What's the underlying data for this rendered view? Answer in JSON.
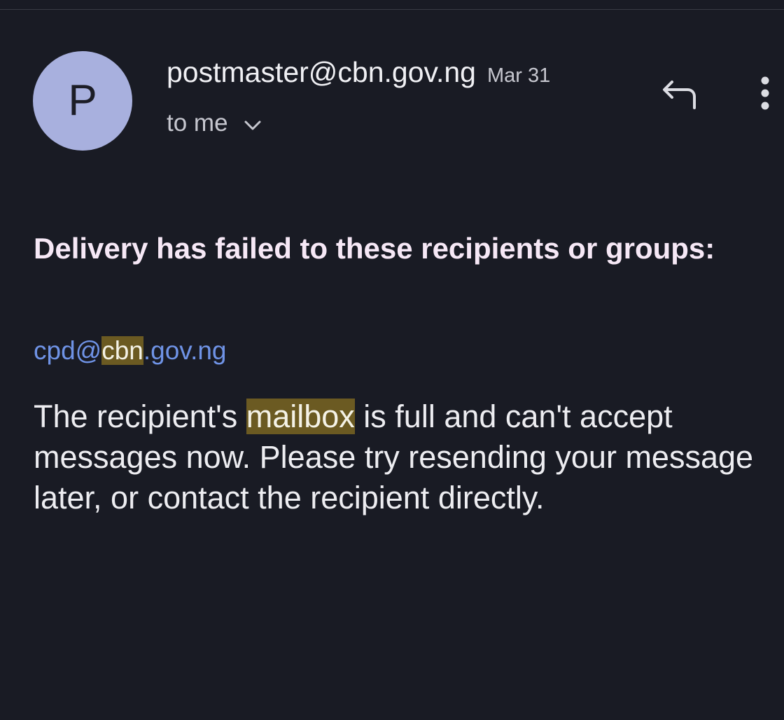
{
  "header": {
    "avatar_letter": "P",
    "sender": "postmaster@cbn.gov.ng",
    "date": "Mar 31",
    "recipient": "to me"
  },
  "actions": {
    "reply_icon": "reply-icon",
    "more_icon": "more-vert-icon",
    "expand_icon": "chevron-down-icon"
  },
  "message": {
    "subject": "Delivery has failed to these recipients or groups:",
    "failed_address": {
      "before": "cpd@",
      "highlight": "cbn",
      "after": ".gov.ng"
    },
    "body": {
      "before": "The recipient's ",
      "highlight": "mailbox",
      "after": " is full and can't accept messages now. Please try resending your message later, or contact the recipient directly."
    }
  },
  "colors": {
    "background": "#191b24",
    "avatar": "#a8b0de",
    "link": "#6f93e6",
    "search_highlight": "#6b5a22",
    "subject": "#f6e8f6"
  }
}
